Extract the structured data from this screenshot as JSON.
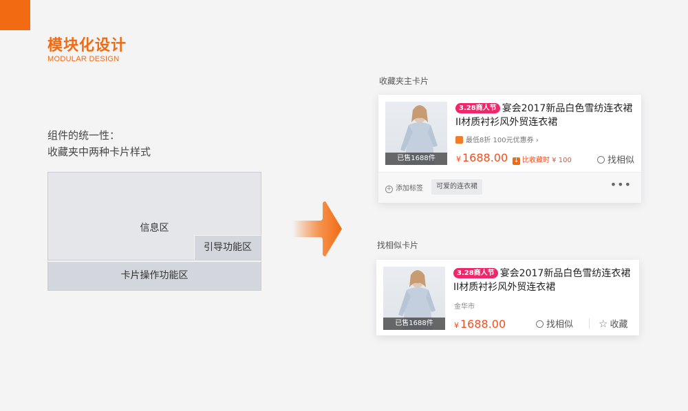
{
  "header": {
    "title": "模块化设计",
    "subtitle": "MODULAR DESIGN",
    "accent_color": "#f26a12"
  },
  "description": {
    "line1": "组件的统一性：",
    "line2": "收藏夹中两种卡片样式"
  },
  "diagram": {
    "info_area": "信息区",
    "guide_area": "引导功能区",
    "card_ops_area": "卡片操作功能区"
  },
  "favorites_card": {
    "label": "收藏夹主卡片",
    "badge": "3.28商人节",
    "title": "宴会2017新品白色雪纺连衣裙II材质衬衫风外贸连衣裙",
    "sold": "已售1688件",
    "discount_info": "最低8折  100元优惠券 ›",
    "currency": "¥",
    "price": "1688.00",
    "price_drop": "比收藏时 ¥ 100",
    "similar": "找相似",
    "add_tag": "添加标签",
    "tag": "可爱的连衣裙",
    "more": "•••"
  },
  "similar_card": {
    "label": "找相似卡片",
    "badge": "3.28商人节",
    "title": "宴会2017新品白色雪纺连衣裙II材质衬衫风外贸连衣裙",
    "sold": "已售1688件",
    "market": "金华市",
    "currency": "¥",
    "price": "1688.00",
    "similar": "找相似",
    "collect": "收藏"
  },
  "colors": {
    "price": "#f24d1d",
    "badge": "#f0266b"
  }
}
